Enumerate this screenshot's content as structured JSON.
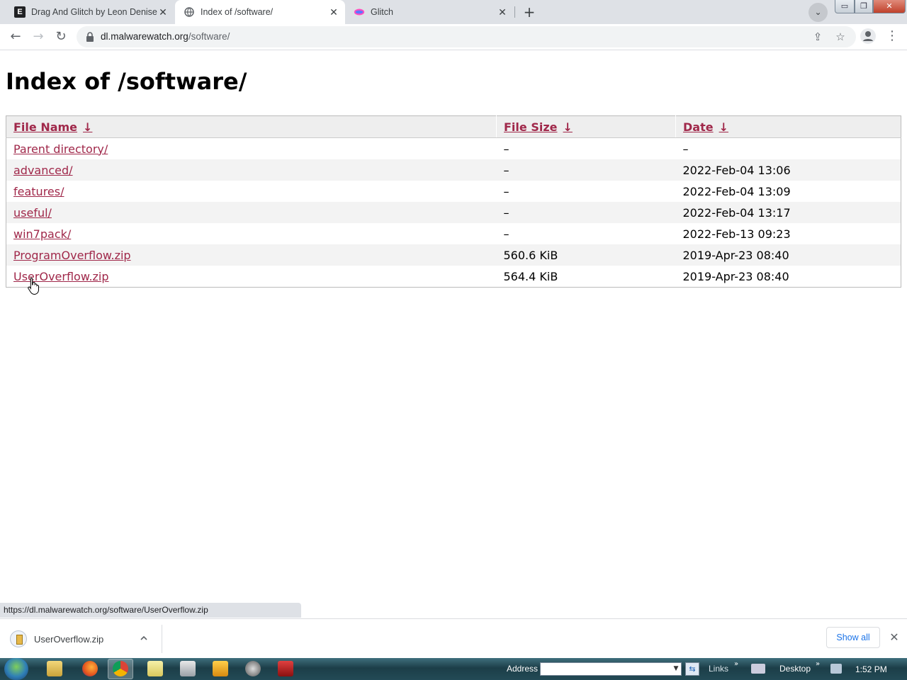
{
  "browser": {
    "tabs": [
      {
        "title": "Drag And Glitch by Leon Denise",
        "favicon": "E",
        "active": false
      },
      {
        "title": "Index of /software/",
        "favicon": "globe-icon",
        "active": true
      },
      {
        "title": "Glitch",
        "favicon": "glitch-fish-icon",
        "active": false
      }
    ],
    "url_host": "dl.malwarewatch.org",
    "url_path": "/software/"
  },
  "page": {
    "title": "Index of /software/",
    "columns": [
      "File Name",
      "File Size",
      "Date"
    ],
    "sort_arrow": "↓",
    "rows": [
      {
        "name": "Parent directory/",
        "size": "–",
        "date": "–"
      },
      {
        "name": "advanced/",
        "size": "–",
        "date": "2022-Feb-04 13:06"
      },
      {
        "name": "features/",
        "size": "–",
        "date": "2022-Feb-04 13:09"
      },
      {
        "name": "useful/",
        "size": "–",
        "date": "2022-Feb-04 13:17"
      },
      {
        "name": "win7pack/",
        "size": "–",
        "date": "2022-Feb-13 09:23"
      },
      {
        "name": "ProgramOverflow.zip",
        "size": "560.6 KiB",
        "date": "2019-Apr-23 08:40"
      },
      {
        "name": "UserOverflow.zip",
        "size": "564.4 KiB",
        "date": "2019-Apr-23 08:40"
      }
    ],
    "link_color": "#a0284a"
  },
  "status_url": "https://dl.malwarewatch.org/software/UserOverflow.zip",
  "downloads": {
    "file": "UserOverflow.zip",
    "show_all": "Show all"
  },
  "taskbar": {
    "address_label": "Address",
    "links_label": "Links",
    "desktop_label": "Desktop",
    "clock": "1:52 PM"
  }
}
